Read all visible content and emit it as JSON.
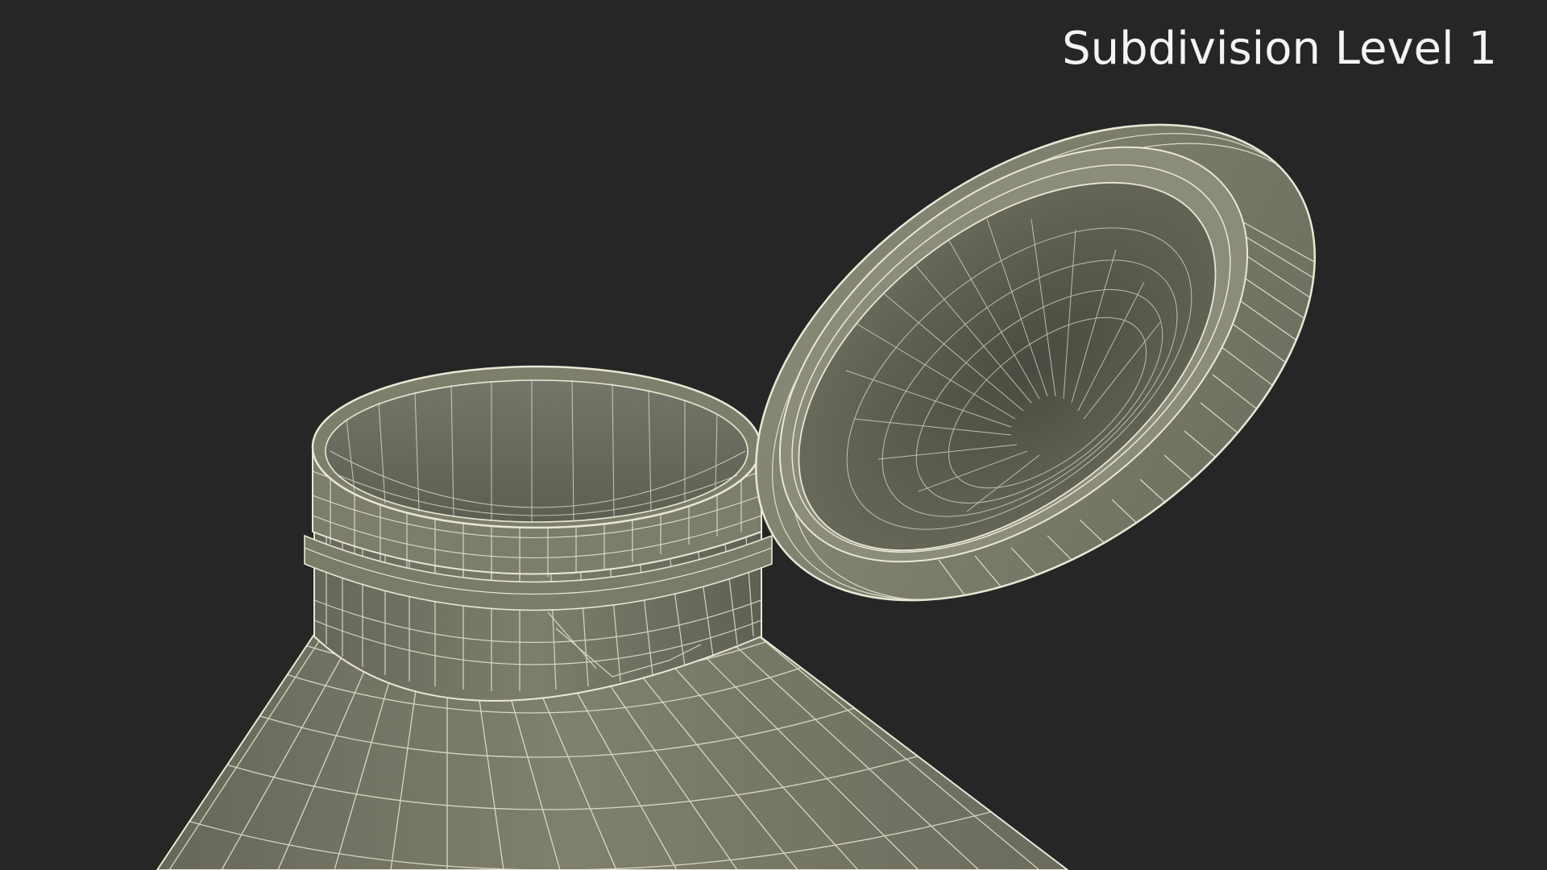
{
  "caption": "Subdivision Level 1",
  "colors": {
    "background": "#262626",
    "surface": "#7d7d6b",
    "surface_dark": "#4e4e44",
    "wire": "#e9e8d6"
  },
  "objects": [
    "bottle-neck",
    "bottle-cap"
  ]
}
